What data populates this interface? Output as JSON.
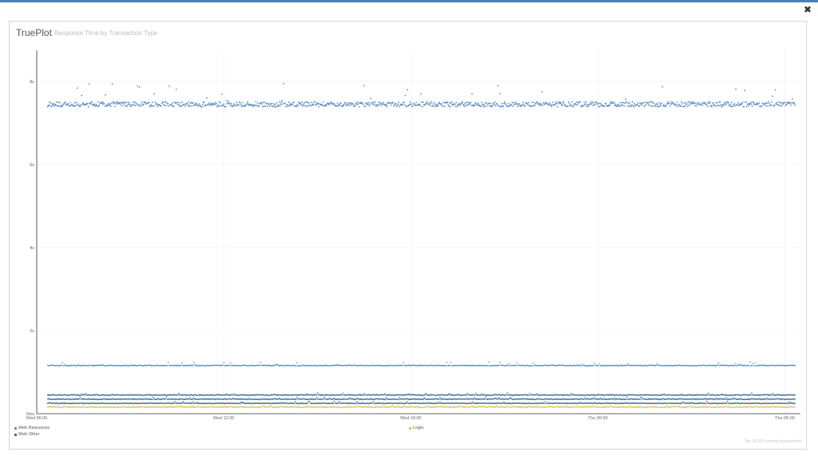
{
  "window": {
    "close_icon": "close-icon",
    "close_glyph": "✖"
  },
  "header": {
    "title": "TruePlot",
    "subtitle": "Response Time by Transaction Type"
  },
  "footnote": "Top 10,000 slowest transactions",
  "colors": {
    "accent": "#4a7fb8",
    "series_blue": "#5b8fbf",
    "series_dark": "#3d6894",
    "series_login": "#e0c060",
    "grid": "#eeeeee",
    "axis": "#333333"
  },
  "legend": [
    {
      "label": "Web Resources",
      "color": "#5b8fbf"
    },
    {
      "label": "Web Other",
      "color": "#3d6894"
    },
    {
      "label": "Login",
      "color": "#e0c060"
    }
  ],
  "chart_data": {
    "type": "scatter",
    "title": "Response Time by Transaction Type",
    "xlabel": "",
    "ylabel": "",
    "x_ticks": [
      "Wed 06:00",
      "Wed 12:00",
      "Wed 18:00",
      "Thu 00:00",
      "Thu 06:00"
    ],
    "x_range_hours": [
      0,
      24.5
    ],
    "y_ticks": [
      "0ms",
      "2s",
      "4s",
      "6s",
      "8s"
    ],
    "y_tick_values": [
      0,
      2,
      4,
      6,
      8
    ],
    "ylim": [
      0,
      8.75
    ],
    "grid": true,
    "legend_position": "bottom",
    "series": [
      {
        "name": "Web Resources",
        "color": "#5b8fbf",
        "baseline_s": 7.45,
        "band": 0.12,
        "outliers_max_s": 7.95
      },
      {
        "name": "Web Resources",
        "color": "#5b8fbf",
        "baseline_s": 1.16,
        "band": 0.02,
        "outliers_max_s": 1.25
      },
      {
        "name": "Web Other",
        "color": "#3d6894",
        "baseline_s": 0.45,
        "band": 0.02,
        "outliers_max_s": 0.5
      },
      {
        "name": "Web Other",
        "color": "#3d6894",
        "baseline_s": 0.35,
        "band": 0.02,
        "outliers_max_s": 0.4
      },
      {
        "name": "Web Other",
        "color": "#3d6894",
        "baseline_s": 0.25,
        "band": 0.015,
        "outliers_max_s": 0.3
      },
      {
        "name": "Login",
        "color": "#e0c060",
        "baseline_s": 0.16,
        "band": 0.03,
        "outliers_max_s": 0.2
      }
    ]
  }
}
